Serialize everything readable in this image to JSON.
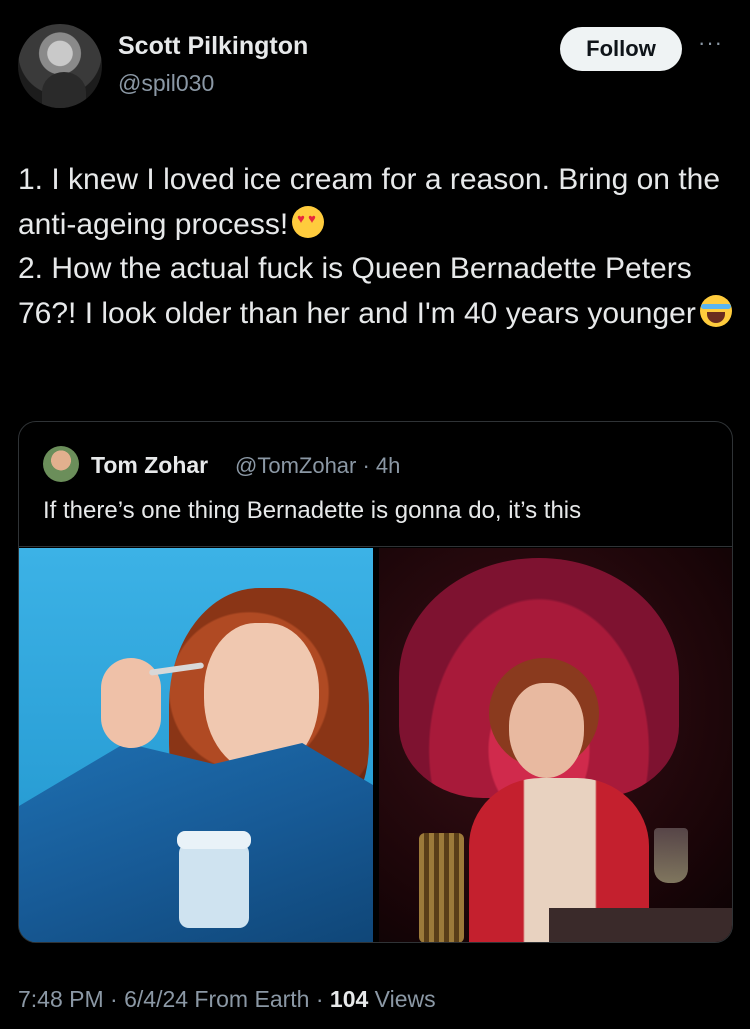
{
  "author": {
    "name": "Scott Pilkington",
    "handle": "@spil030",
    "follow_label": "Follow",
    "more_label": "···"
  },
  "tweet": {
    "line1": "1. I knew I loved ice cream for a reason. Bring on the anti-ageing process!",
    "line1_emoji": "smiling-face-with-heart-eyes",
    "line2": "2. How the actual fuck is Queen Bernadette Peters 76?! I look older than her and I'm 40 years younger",
    "line2_emoji": "loudly-crying-face"
  },
  "quoted": {
    "name": "Tom Zohar",
    "meta": "@TomZohar · 4h",
    "text": "If there’s one thing Bernadette is gonna do, it’s this"
  },
  "footer": {
    "time": "7:48 PM · 6/4/24 From Earth · ",
    "views_count": "104",
    "views_label": " Views"
  }
}
